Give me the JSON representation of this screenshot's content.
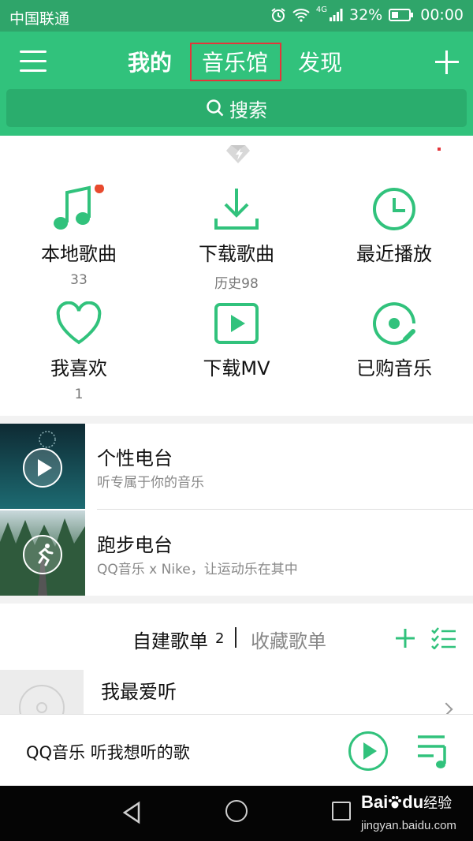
{
  "status_bar": {
    "carrier": "中国联通",
    "network": "4G",
    "battery": "32%",
    "time": "00:00"
  },
  "header": {
    "tabs": [
      {
        "label": "我的",
        "active": true
      },
      {
        "label": "音乐馆",
        "highlighted": true
      },
      {
        "label": "发现"
      }
    ],
    "search_label": "搜索"
  },
  "quick_grid": [
    {
      "label": "本地歌曲",
      "sub": "33",
      "icon": "music-note-icon"
    },
    {
      "label": "下载歌曲",
      "sub": "历史98",
      "icon": "download-icon"
    },
    {
      "label": "最近播放",
      "sub": "",
      "icon": "clock-icon"
    },
    {
      "label": "我喜欢",
      "sub": "1",
      "icon": "heart-icon"
    },
    {
      "label": "下载MV",
      "sub": "",
      "icon": "mv-play-icon"
    },
    {
      "label": "已购音乐",
      "sub": "",
      "icon": "purchased-disc-icon"
    }
  ],
  "radios": [
    {
      "title": "个性电台",
      "subtitle": "听专属于你的音乐"
    },
    {
      "title": "跑步电台",
      "subtitle": "QQ音乐 x Nike，让运动乐在其中"
    }
  ],
  "playlists": {
    "self_tab": "自建歌单",
    "self_count": "2",
    "fav_tab": "收藏歌单",
    "items": [
      {
        "name": "我最爱听"
      }
    ]
  },
  "player": {
    "text": "QQ音乐 听我想听的歌"
  },
  "watermark": {
    "brand": "Bai",
    "brand2": "du",
    "cn": "经验",
    "url": "jingyan.baidu.com"
  },
  "colors": {
    "accent": "#31c27c",
    "statusbar": "#2fa56a",
    "highlight_box": "#e4353a"
  }
}
